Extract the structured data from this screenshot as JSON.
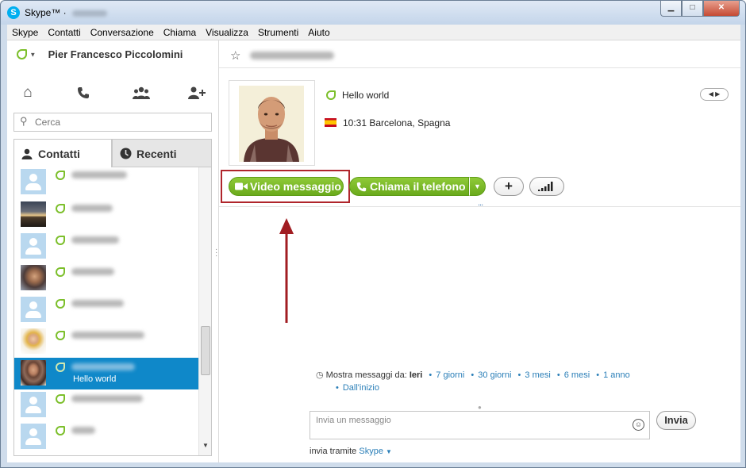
{
  "window": {
    "title": "Skype™ · ",
    "controls": {
      "minimize": "▁",
      "maximize": "□",
      "close": "✕"
    }
  },
  "menu": [
    "Skype",
    "Contatti",
    "Conversazione",
    "Chiama",
    "Visualizza",
    "Strumenti",
    "Aiuto"
  ],
  "profile": {
    "name": "Pier Francesco Piccolomini",
    "status_icon": "skype-status-online-icon"
  },
  "nav_icons": [
    "home-icon",
    "phone-icon",
    "group-icon",
    "add-contact-icon"
  ],
  "search": {
    "placeholder": "Cerca",
    "value": ""
  },
  "tabs": [
    {
      "label": "Contatti",
      "icon": "person-icon",
      "active": true
    },
    {
      "label": "Recenti",
      "icon": "clock-icon",
      "active": false
    }
  ],
  "contacts": [
    {
      "avatar": "default",
      "selected": false,
      "mood": ""
    },
    {
      "avatar": "sunset-photo",
      "selected": false,
      "mood": ""
    },
    {
      "avatar": "default",
      "selected": false,
      "mood": ""
    },
    {
      "avatar": "person-photo",
      "selected": false,
      "mood": ""
    },
    {
      "avatar": "default",
      "selected": false,
      "mood": ""
    },
    {
      "avatar": "woman-photo",
      "selected": false,
      "mood": ""
    },
    {
      "avatar": "man-photo",
      "selected": true,
      "mood": "Hello world"
    },
    {
      "avatar": "default",
      "selected": false,
      "mood": ""
    },
    {
      "avatar": "default",
      "selected": false,
      "mood": ""
    }
  ],
  "conversation": {
    "contact_mood": "Hello world",
    "location": "10:31 Barcelona, Spagna",
    "flag": "spain-flag-icon",
    "buttons": {
      "video": "Video messaggio",
      "call": "Chiama il telefono",
      "add": "+",
      "signal": ".ıll"
    },
    "ellipsis": "...",
    "history": {
      "label": "Mostra messaggi da:",
      "current": "Ieri",
      "options": [
        "7 giorni",
        "30 giorni",
        "3 mesi",
        "6 mesi",
        "1 anno",
        "Dall'inizio"
      ]
    },
    "message": {
      "placeholder": "Invia un messaggio",
      "value": ""
    },
    "send_label": "Invia",
    "via_label": "invia tramite",
    "via_value": "Skype"
  },
  "colors": {
    "accent_green": "#7cbf2b",
    "selection_blue": "#0f88c9",
    "link_blue": "#2b7fb8",
    "highlight_red": "#b0252b"
  }
}
